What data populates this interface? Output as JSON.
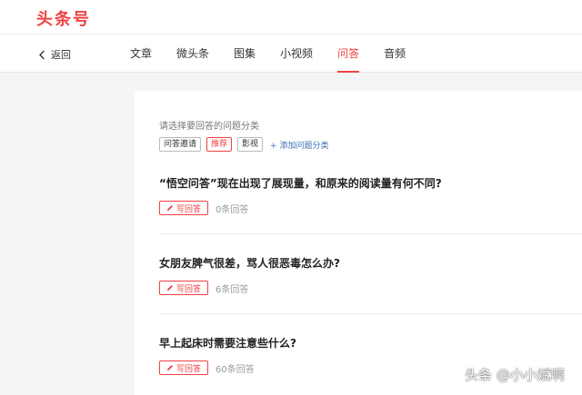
{
  "header": {
    "logo": "头条号",
    "brand_color": "#f04142"
  },
  "nav": {
    "back_label": "返回",
    "tabs": [
      {
        "label": "文章",
        "active": false
      },
      {
        "label": "微头条",
        "active": false
      },
      {
        "label": "图集",
        "active": false
      },
      {
        "label": "小视频",
        "active": false
      },
      {
        "label": "问答",
        "active": true
      },
      {
        "label": "音频",
        "active": false
      }
    ]
  },
  "categories": {
    "prompt": "请选择要回答的问题分类",
    "chips": [
      {
        "label": "问答邀请",
        "selected": false
      },
      {
        "label": "推荐",
        "selected": true
      },
      {
        "label": "影视",
        "selected": false
      }
    ],
    "add_label": "添加问题分类",
    "add_icon": "plus-icon"
  },
  "questions": [
    {
      "title": "“悟空问答”现在出现了展现量，和原来的阅读量有何不同?",
      "answer_label": "写回答",
      "count": "0条回答"
    },
    {
      "title": "女朋友脾气很差，骂人很恶毒怎么办?",
      "answer_label": "写回答",
      "count": "6条回答"
    },
    {
      "title": "早上起床时需要注意些什么?",
      "answer_label": "写回答",
      "count": "60条回答"
    }
  ],
  "watermark": "头条 @小小斌啊"
}
